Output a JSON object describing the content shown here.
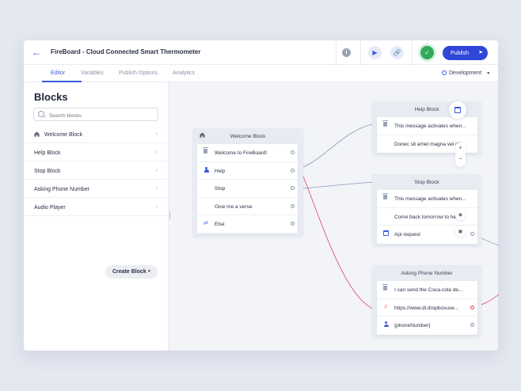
{
  "header": {
    "back_icon": "arrow-left-icon",
    "title": "FireBoard - Cloud Connected Smart Thermometer",
    "publish_label": "Publish"
  },
  "tabs": [
    {
      "label": "Editor",
      "active": true
    },
    {
      "label": "Variables"
    },
    {
      "label": "Publish Options"
    },
    {
      "label": "Analytics"
    }
  ],
  "environment": {
    "selected": "Development"
  },
  "sidebar": {
    "title": "Blocks",
    "search_placeholder": "Search blocks",
    "items": [
      {
        "label": "Welcome Block",
        "icon": "home-icon"
      },
      {
        "label": "Help Block"
      },
      {
        "label": "Stop Block"
      },
      {
        "label": "Asking Phone Number"
      },
      {
        "label": "Audio Player"
      }
    ],
    "create_label": "Create Block"
  },
  "nodes": {
    "welcome": {
      "title": "Welcome Block",
      "rows": [
        "Welcome to FireBoard!",
        "Help",
        "Stop",
        "Give me a verse",
        "Else"
      ]
    },
    "help": {
      "title": "Help Block",
      "rows": [
        "This message activates when...",
        "Donec sit amet magna vel oll..."
      ]
    },
    "stop": {
      "title": "Stop Block",
      "rows": [
        "This message activates when...",
        "Come back tomorrow to hea...",
        "Api request"
      ]
    },
    "phone": {
      "title": "Asking Phone Number",
      "rows": [
        "I can send the Coca-cola de...",
        "https://www.dl.dropboxuse...",
        "{phoneNumber}"
      ]
    }
  },
  "colors": {
    "accent": "#3c5bd8",
    "publish": "#3046d8",
    "success": "#2faa5a",
    "audio_link": "#e0415a"
  }
}
